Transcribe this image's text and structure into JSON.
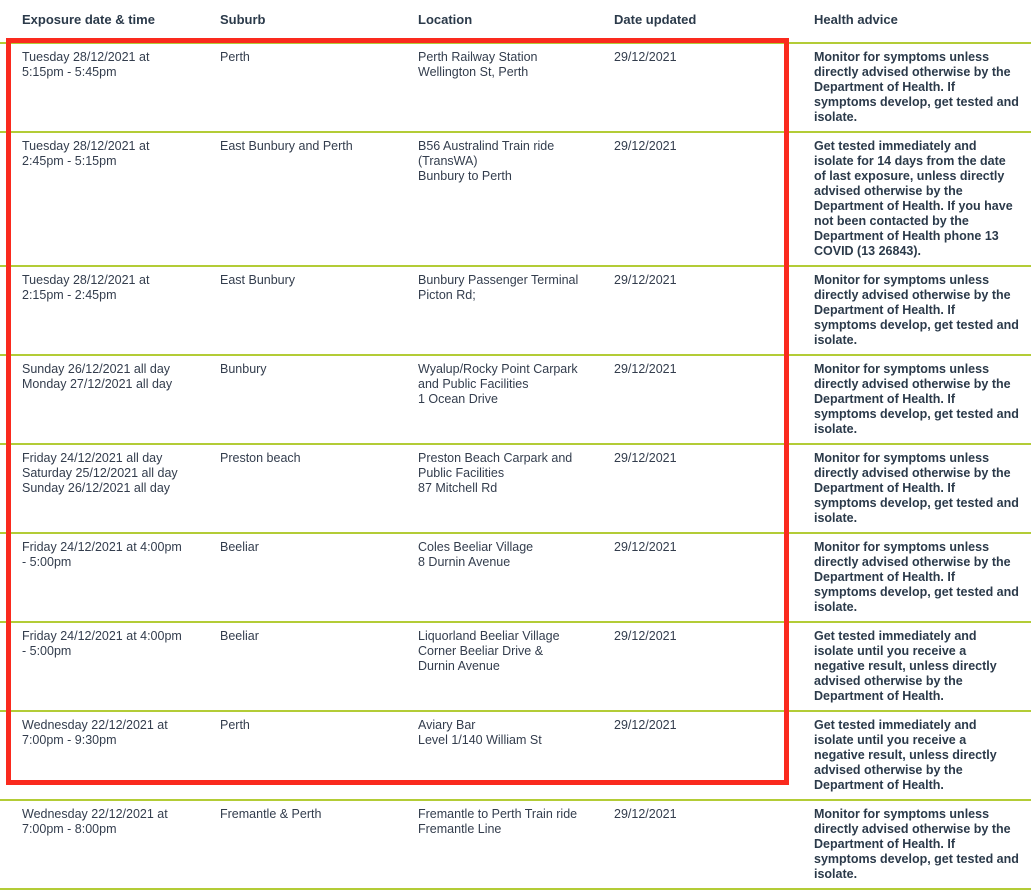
{
  "table": {
    "columns": [
      {
        "key": "exposure",
        "label": "Exposure date & time"
      },
      {
        "key": "suburb",
        "label": "Suburb"
      },
      {
        "key": "location",
        "label": "Location"
      },
      {
        "key": "updated",
        "label": "Date updated"
      },
      {
        "key": "advice",
        "label": "Health advice"
      }
    ],
    "rows": [
      {
        "exposure": "Tuesday 28/12/2021 at 5:15pm - 5:45pm",
        "suburb": "Perth",
        "location": "Perth Railway Station\nWellington St, Perth",
        "updated": "29/12/2021",
        "advice": "Monitor for symptoms unless directly advised otherwise by the Department of Health. If symptoms develop, get tested and isolate."
      },
      {
        "exposure": "Tuesday 28/12/2021 at 2:45pm - 5:15pm",
        "suburb": "East Bunbury and Perth",
        "location": "B56 Australind Train ride (TransWA)\nBunbury to Perth",
        "updated": "29/12/2021",
        "advice": "Get tested immediately and isolate for 14 days from the date of last exposure, unless directly advised otherwise by the Department of Health. If you have not been contacted by the Department of Health phone 13 COVID (13 26843)."
      },
      {
        "exposure": "Tuesday 28/12/2021 at 2:15pm - 2:45pm",
        "suburb": "East Bunbury",
        "location": "Bunbury Passenger Terminal\nPicton Rd;",
        "updated": "29/12/2021",
        "advice": "Monitor for symptoms unless directly advised otherwise by the Department of Health. If symptoms develop, get tested and isolate."
      },
      {
        "exposure": "Sunday 26/12/2021 all day\nMonday 27/12/2021 all day",
        "suburb": "Bunbury",
        "location": "Wyalup/Rocky Point Carpark and Public Facilities\n1 Ocean Drive",
        "updated": "29/12/2021",
        "advice": "Monitor for symptoms unless directly advised otherwise by the Department of Health. If symptoms develop, get tested and isolate."
      },
      {
        "exposure": "Friday 24/12/2021 all day\nSaturday 25/12/2021 all day\nSunday 26/12/2021 all day",
        "suburb": "Preston beach",
        "location": "Preston Beach Carpark and Public Facilities\n87 Mitchell Rd",
        "updated": "29/12/2021",
        "advice": "Monitor for symptoms unless directly advised otherwise by the Department of Health. If symptoms develop, get tested and isolate."
      },
      {
        "exposure": "Friday 24/12/2021 at 4:00pm - 5:00pm",
        "suburb": "Beeliar",
        "location": "Coles Beeliar Village\n8 Durnin Avenue",
        "updated": "29/12/2021",
        "advice": "Monitor for symptoms unless directly advised otherwise by the Department of Health. If symptoms develop, get tested and isolate."
      },
      {
        "exposure": "Friday 24/12/2021 at 4:00pm - 5:00pm",
        "suburb": "Beeliar",
        "location": "Liquorland Beeliar Village\nCorner Beeliar Drive & Durnin Avenue",
        "updated": "29/12/2021",
        "advice": "Get tested immediately and isolate until you receive a negative result, unless directly advised otherwise by the Department of Health."
      },
      {
        "exposure": "Wednesday 22/12/2021 at 7:00pm - 9:30pm",
        "suburb": "Perth",
        "location": "Aviary Bar\nLevel 1/140 William St",
        "updated": "29/12/2021",
        "advice": "Get tested immediately and isolate until you receive a negative result, unless directly advised otherwise by the Department of Health."
      },
      {
        "exposure": "Wednesday 22/12/2021 at 7:00pm - 8:00pm",
        "suburb": "Fremantle & Perth",
        "location": "Fremantle to Perth Train ride\nFremantle Line",
        "updated": "29/12/2021",
        "advice": "Monitor for symptoms unless directly advised otherwise by the Department of Health. If symptoms develop, get tested and isolate."
      }
    ]
  },
  "annotation": {
    "highlight_color": "#fa2a1e"
  },
  "theme": {
    "row_divider_color": "#b3cc36",
    "text_color": "#333d4d",
    "heading_color": "#2b3a4a"
  }
}
